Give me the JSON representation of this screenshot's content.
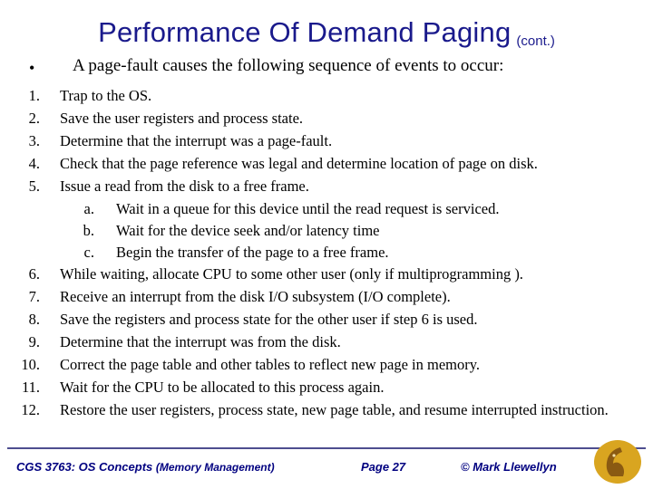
{
  "slide": {
    "title": "Performance Of Demand Paging",
    "title_suffix": "(cont.)",
    "bullet_marker": "•",
    "bullet_text": "A page-fault causes the following sequence of events to occur:",
    "items": [
      {
        "num": "1.",
        "text": "Trap to the OS."
      },
      {
        "num": "2.",
        "text": "Save the user registers and process state."
      },
      {
        "num": "3.",
        "text": "Determine that the interrupt was a page-fault."
      },
      {
        "num": "4.",
        "text": "Check that the page reference was legal and determine location of page on disk."
      },
      {
        "num": "5.",
        "text": "Issue a read from the disk to a free frame."
      }
    ],
    "subitems": [
      {
        "num": "a.",
        "text": "Wait in a queue for this device until the read request is serviced."
      },
      {
        "num": "b.",
        "text": "Wait for the device seek and/or latency time"
      },
      {
        "num": "c.",
        "text": "Begin the transfer of the page to a free frame."
      }
    ],
    "items2": [
      {
        "num": "6.",
        "text": "While waiting, allocate CPU to some other user (only if multiprogramming )."
      },
      {
        "num": "7.",
        "text": "Receive an interrupt from the disk I/O subsystem (I/O complete)."
      },
      {
        "num": "8.",
        "text": "Save the registers and process state for the other user if step 6 is used."
      },
      {
        "num": "9.",
        "text": "Determine that the interrupt was from the disk."
      },
      {
        "num": "10.",
        "text": "Correct the page table and other tables to reflect new page in memory."
      },
      {
        "num": "11.",
        "text": "Wait for the CPU to be allocated to this process again."
      },
      {
        "num": "12.",
        "text": "Restore the user registers, process state, new page table, and resume interrupted instruction."
      }
    ]
  },
  "footer": {
    "course": "CGS 3763: OS Concepts ",
    "topic": "(Memory Management)",
    "page": "Page 27",
    "copyright": "© Mark Llewellyn"
  },
  "colors": {
    "title": "#1a1a8c",
    "footer_text": "#000080",
    "footer_rule": "#4d4d8f",
    "logo_gold": "#d9a520",
    "logo_dark": "#8a5a12"
  }
}
